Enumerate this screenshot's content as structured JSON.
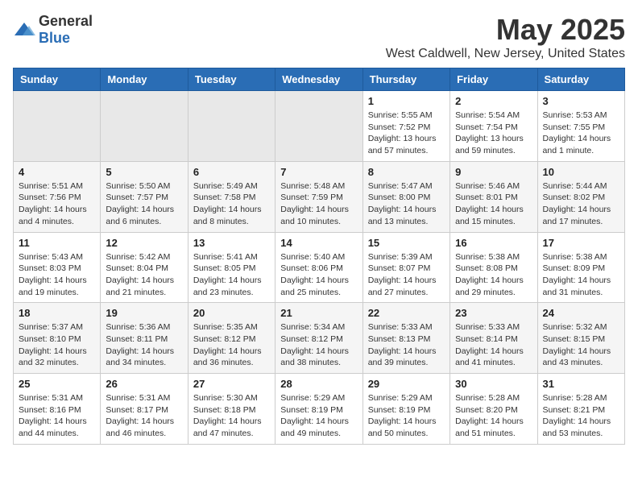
{
  "logo": {
    "general": "General",
    "blue": "Blue"
  },
  "title": "May 2025",
  "location": "West Caldwell, New Jersey, United States",
  "weekdays": [
    "Sunday",
    "Monday",
    "Tuesday",
    "Wednesday",
    "Thursday",
    "Friday",
    "Saturday"
  ],
  "weeks": [
    [
      {
        "day": "",
        "info": ""
      },
      {
        "day": "",
        "info": ""
      },
      {
        "day": "",
        "info": ""
      },
      {
        "day": "",
        "info": ""
      },
      {
        "day": "1",
        "info": "Sunrise: 5:55 AM\nSunset: 7:52 PM\nDaylight: 13 hours\nand 57 minutes."
      },
      {
        "day": "2",
        "info": "Sunrise: 5:54 AM\nSunset: 7:54 PM\nDaylight: 13 hours\nand 59 minutes."
      },
      {
        "day": "3",
        "info": "Sunrise: 5:53 AM\nSunset: 7:55 PM\nDaylight: 14 hours\nand 1 minute."
      }
    ],
    [
      {
        "day": "4",
        "info": "Sunrise: 5:51 AM\nSunset: 7:56 PM\nDaylight: 14 hours\nand 4 minutes."
      },
      {
        "day": "5",
        "info": "Sunrise: 5:50 AM\nSunset: 7:57 PM\nDaylight: 14 hours\nand 6 minutes."
      },
      {
        "day": "6",
        "info": "Sunrise: 5:49 AM\nSunset: 7:58 PM\nDaylight: 14 hours\nand 8 minutes."
      },
      {
        "day": "7",
        "info": "Sunrise: 5:48 AM\nSunset: 7:59 PM\nDaylight: 14 hours\nand 10 minutes."
      },
      {
        "day": "8",
        "info": "Sunrise: 5:47 AM\nSunset: 8:00 PM\nDaylight: 14 hours\nand 13 minutes."
      },
      {
        "day": "9",
        "info": "Sunrise: 5:46 AM\nSunset: 8:01 PM\nDaylight: 14 hours\nand 15 minutes."
      },
      {
        "day": "10",
        "info": "Sunrise: 5:44 AM\nSunset: 8:02 PM\nDaylight: 14 hours\nand 17 minutes."
      }
    ],
    [
      {
        "day": "11",
        "info": "Sunrise: 5:43 AM\nSunset: 8:03 PM\nDaylight: 14 hours\nand 19 minutes."
      },
      {
        "day": "12",
        "info": "Sunrise: 5:42 AM\nSunset: 8:04 PM\nDaylight: 14 hours\nand 21 minutes."
      },
      {
        "day": "13",
        "info": "Sunrise: 5:41 AM\nSunset: 8:05 PM\nDaylight: 14 hours\nand 23 minutes."
      },
      {
        "day": "14",
        "info": "Sunrise: 5:40 AM\nSunset: 8:06 PM\nDaylight: 14 hours\nand 25 minutes."
      },
      {
        "day": "15",
        "info": "Sunrise: 5:39 AM\nSunset: 8:07 PM\nDaylight: 14 hours\nand 27 minutes."
      },
      {
        "day": "16",
        "info": "Sunrise: 5:38 AM\nSunset: 8:08 PM\nDaylight: 14 hours\nand 29 minutes."
      },
      {
        "day": "17",
        "info": "Sunrise: 5:38 AM\nSunset: 8:09 PM\nDaylight: 14 hours\nand 31 minutes."
      }
    ],
    [
      {
        "day": "18",
        "info": "Sunrise: 5:37 AM\nSunset: 8:10 PM\nDaylight: 14 hours\nand 32 minutes."
      },
      {
        "day": "19",
        "info": "Sunrise: 5:36 AM\nSunset: 8:11 PM\nDaylight: 14 hours\nand 34 minutes."
      },
      {
        "day": "20",
        "info": "Sunrise: 5:35 AM\nSunset: 8:12 PM\nDaylight: 14 hours\nand 36 minutes."
      },
      {
        "day": "21",
        "info": "Sunrise: 5:34 AM\nSunset: 8:12 PM\nDaylight: 14 hours\nand 38 minutes."
      },
      {
        "day": "22",
        "info": "Sunrise: 5:33 AM\nSunset: 8:13 PM\nDaylight: 14 hours\nand 39 minutes."
      },
      {
        "day": "23",
        "info": "Sunrise: 5:33 AM\nSunset: 8:14 PM\nDaylight: 14 hours\nand 41 minutes."
      },
      {
        "day": "24",
        "info": "Sunrise: 5:32 AM\nSunset: 8:15 PM\nDaylight: 14 hours\nand 43 minutes."
      }
    ],
    [
      {
        "day": "25",
        "info": "Sunrise: 5:31 AM\nSunset: 8:16 PM\nDaylight: 14 hours\nand 44 minutes."
      },
      {
        "day": "26",
        "info": "Sunrise: 5:31 AM\nSunset: 8:17 PM\nDaylight: 14 hours\nand 46 minutes."
      },
      {
        "day": "27",
        "info": "Sunrise: 5:30 AM\nSunset: 8:18 PM\nDaylight: 14 hours\nand 47 minutes."
      },
      {
        "day": "28",
        "info": "Sunrise: 5:29 AM\nSunset: 8:19 PM\nDaylight: 14 hours\nand 49 minutes."
      },
      {
        "day": "29",
        "info": "Sunrise: 5:29 AM\nSunset: 8:19 PM\nDaylight: 14 hours\nand 50 minutes."
      },
      {
        "day": "30",
        "info": "Sunrise: 5:28 AM\nSunset: 8:20 PM\nDaylight: 14 hours\nand 51 minutes."
      },
      {
        "day": "31",
        "info": "Sunrise: 5:28 AM\nSunset: 8:21 PM\nDaylight: 14 hours\nand 53 minutes."
      }
    ]
  ]
}
